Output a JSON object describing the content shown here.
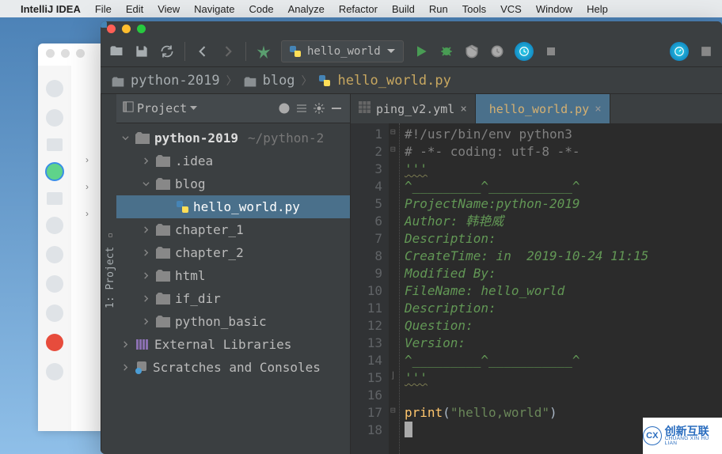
{
  "menubar": {
    "app": "IntelliJ IDEA",
    "items": [
      "File",
      "Edit",
      "View",
      "Navigate",
      "Code",
      "Analyze",
      "Refactor",
      "Build",
      "Run",
      "Tools",
      "VCS",
      "Window",
      "Help"
    ]
  },
  "toolbar": {
    "run_config": "hello_world"
  },
  "breadcrumb": {
    "root": "python-2019",
    "folder": "blog",
    "file": "hello_world.py"
  },
  "project": {
    "header": "Project",
    "root_name": "python-2019",
    "root_path": "~/python-2",
    "nodes": [
      {
        "name": ".idea",
        "indent": 1,
        "expanded": false,
        "type": "folder"
      },
      {
        "name": "blog",
        "indent": 1,
        "expanded": true,
        "type": "folder"
      },
      {
        "name": "hello_world.py",
        "indent": 2,
        "type": "python",
        "selected": true
      },
      {
        "name": "chapter_1",
        "indent": 1,
        "expanded": false,
        "type": "folder"
      },
      {
        "name": "chapter_2",
        "indent": 1,
        "expanded": false,
        "type": "folder"
      },
      {
        "name": "html",
        "indent": 1,
        "expanded": false,
        "type": "folder"
      },
      {
        "name": "if_dir",
        "indent": 1,
        "expanded": false,
        "type": "folder"
      },
      {
        "name": "python_basic",
        "indent": 1,
        "expanded": false,
        "type": "folder"
      }
    ],
    "external": "External Libraries",
    "scratches": "Scratches and Consoles"
  },
  "sidebar_tab": "1: Project",
  "tabs": [
    {
      "name": "ping_v2.yml",
      "type": "yml",
      "active": false
    },
    {
      "name": "hello_world.py",
      "type": "python",
      "active": true
    }
  ],
  "code": {
    "line_count": 18,
    "lines": [
      {
        "t": "cmt",
        "s": "#!/usr/bin/env python3"
      },
      {
        "t": "cmt",
        "s": "# -*- coding: utf-8 -*-"
      },
      {
        "t": "docw",
        "s": "'''"
      },
      {
        "t": "doc",
        "s": "^_________^___________^"
      },
      {
        "t": "doc",
        "s": "ProjectName:python-2019"
      },
      {
        "t": "doc",
        "s": "Author: 韩艳威"
      },
      {
        "t": "doc",
        "s": "Description:"
      },
      {
        "t": "doc",
        "s": "CreateTime: in  2019-10-24 11:15"
      },
      {
        "t": "doc",
        "s": "Modified By:"
      },
      {
        "t": "doc",
        "s": "FileName: hello_world"
      },
      {
        "t": "doc",
        "s": "Description:"
      },
      {
        "t": "doc",
        "s": "Question:"
      },
      {
        "t": "doc",
        "s": "Version:"
      },
      {
        "t": "doc",
        "s": "^_________^___________^"
      },
      {
        "t": "docw",
        "s": "'''"
      },
      {
        "t": "blank",
        "s": ""
      },
      {
        "t": "print",
        "s": ""
      },
      {
        "t": "caret",
        "s": ""
      }
    ],
    "print_fn": "print",
    "print_open": "(",
    "print_str": "\"hello,world\"",
    "print_close": ")"
  },
  "watermark": {
    "cn": "创新互联",
    "en": "CHUANG XIN HU LIAN",
    "logo": "CX"
  }
}
